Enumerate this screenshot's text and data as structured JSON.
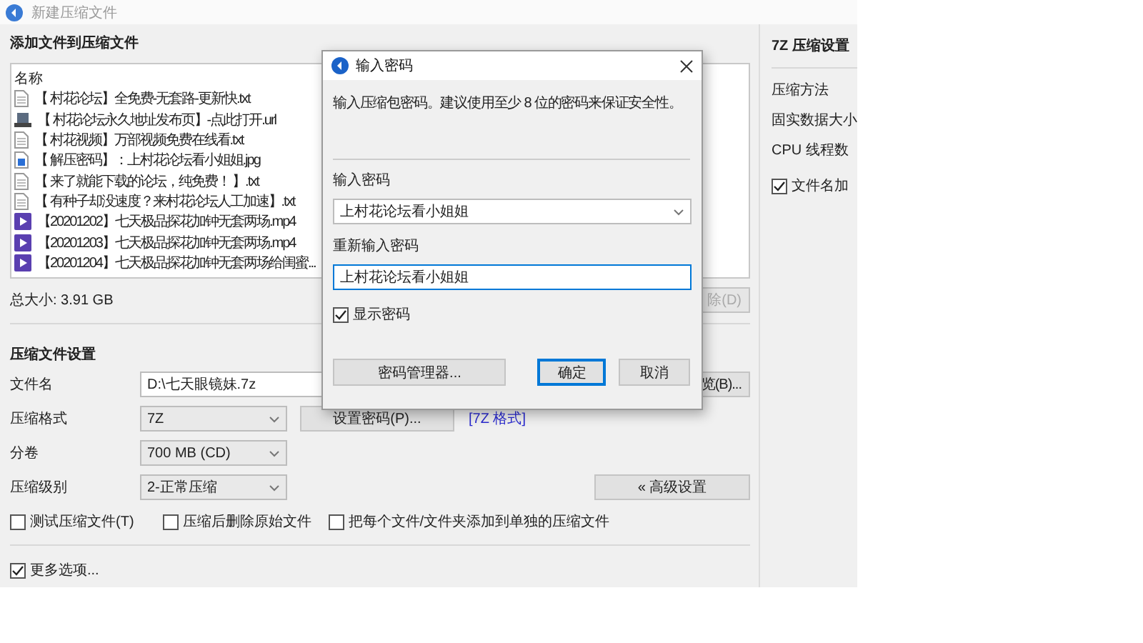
{
  "window": {
    "title": "新建压缩文件"
  },
  "files_section": {
    "heading": "添加文件到压缩文件",
    "column": "名称",
    "files": [
      {
        "name": "【 村花论坛】全免费-无套路-更新快.txt",
        "kind": "text"
      },
      {
        "name": "【 村花论坛永久地址发布页】-点此打开.url",
        "kind": "link"
      },
      {
        "name": "【 村花视频】万部视频免费在线看.txt",
        "kind": "text"
      },
      {
        "name": "【 解压密码】：上村花论坛看小姐姐.jpg",
        "kind": "image"
      },
      {
        "name": "【 来了就能下载的论坛，纯免费！ 】.txt",
        "kind": "text"
      },
      {
        "name": "【 有种子却没速度？来村花论坛人工加速】.txt",
        "kind": "text"
      },
      {
        "name": "【20201202】七天极品探花加钟无套两场.mp4",
        "kind": "video"
      },
      {
        "name": "【20201203】七天极品探花加钟无套两场.mp4",
        "kind": "video"
      },
      {
        "name": "【20201204】七天极品探花加钟无套两场给闺蜜...",
        "kind": "video"
      }
    ],
    "total": "总大小: 3.91 GB",
    "delete_button": "除(D)"
  },
  "settings": {
    "heading": "压缩文件设置",
    "filename_label": "文件名",
    "filename": "D:\\七天眼镜妹.7z",
    "browse_button": "览(B)...",
    "format_label": "压缩格式",
    "format": "7Z",
    "password_button": "设置密码(P)...",
    "format_link": "[7Z 格式]",
    "volume_label": "分卷",
    "volume": "700 MB (CD)",
    "compression_label": "压缩级别",
    "compression": "2-正常压缩",
    "advanced_button": "« 高级设置",
    "options": [
      {
        "label": "测试压缩文件(T)",
        "checked": false
      },
      {
        "label": "压缩后删除原始文件",
        "checked": false
      },
      {
        "label": "把每个文件/文件夹添加到单独的压缩文件",
        "checked": false
      }
    ]
  },
  "more_options": {
    "label": "更多选项...",
    "checked": true
  },
  "side_panel": {
    "title": "7Z 压缩设置",
    "rows": [
      "压缩方法",
      "固实数据大小",
      "CPU 线程数"
    ],
    "encrypt_names": {
      "label": "文件名加",
      "checked": true
    }
  },
  "dialog": {
    "title": "输入密码",
    "message": "输入压缩包密码。建议使用至少 8 位的密码来保证安全性。",
    "password_label": "输入密码",
    "password": "上村花论坛看小姐姐",
    "confirm_label": "重新输入密码",
    "confirm": "上村花论坛看小姐姐",
    "show_password": {
      "label": "显示密码",
      "checked": true
    },
    "buttons": [
      {
        "label": "密码管理器...",
        "default": false
      },
      {
        "label": "确定",
        "default": true
      },
      {
        "label": "取消",
        "default": false
      }
    ]
  }
}
